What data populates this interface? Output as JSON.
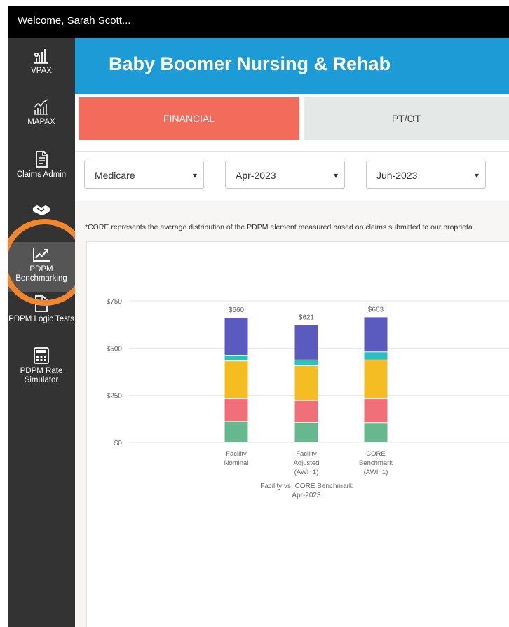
{
  "topbar": {
    "welcome": "Welcome, Sarah Scott..."
  },
  "sidebar": {
    "items": [
      {
        "label": "VPAX",
        "icon": "signal-bars-icon"
      },
      {
        "label": "MAPAX",
        "icon": "trend-bars-icon"
      },
      {
        "label": "Claims Admin",
        "icon": "document-icon"
      },
      {
        "label": "",
        "icon": "handshake-icon"
      },
      {
        "label": "PDPM Benchmarking",
        "icon": "line-chart-icon"
      },
      {
        "label": "PDPM Logic Tests",
        "icon": "document-edit-icon"
      },
      {
        "label": "PDPM Rate Simulator",
        "icon": "calculator-icon"
      }
    ]
  },
  "header": {
    "title": "Baby Boomer Nursing & Rehab"
  },
  "tabs": [
    {
      "label": "FINANCIAL",
      "active": true
    },
    {
      "label": "PT/OT",
      "active": false
    }
  ],
  "filters": {
    "payer": "Medicare",
    "start": "Apr-2023",
    "end": "Jun-2023"
  },
  "note": "*CORE represents the average distribution of the PDPM element measured based on claims submitted to our proprieta",
  "colors": {
    "accent_header": "#1D9BD7",
    "tab_active": "#F26B5B",
    "highlight": "#F0872E",
    "seg_green": "#66B98E",
    "seg_red": "#F06F78",
    "seg_yellow": "#F4BE23",
    "seg_teal": "#2BBFBF",
    "seg_purple": "#5A5ABF"
  },
  "chart_data": {
    "type": "bar",
    "stacked": true,
    "categories": [
      [
        "Facility",
        "Nominal"
      ],
      [
        "Facility",
        "Adjusted",
        "(AWI=1)"
      ],
      [
        "CORE",
        "Benchmark",
        "(AWI=1)"
      ]
    ],
    "totals": [
      "$660",
      "$621",
      "$663"
    ],
    "series": [
      {
        "color_key": "seg_green",
        "values": [
          110,
          105,
          103
        ]
      },
      {
        "color_key": "seg_red",
        "values": [
          120,
          115,
          127
        ]
      },
      {
        "color_key": "seg_yellow",
        "values": [
          200,
          185,
          205
        ]
      },
      {
        "color_key": "seg_teal",
        "values": [
          30,
          30,
          43
        ]
      },
      {
        "color_key": "seg_purple",
        "values": [
          200,
          186,
          185
        ]
      }
    ],
    "y_ticks": [
      "$0",
      "$250",
      "$500",
      "$750"
    ],
    "ylim": [
      0,
      750
    ],
    "xlabel": [
      "Facility vs. CORE Benchmark",
      "Apr-2023"
    ]
  }
}
